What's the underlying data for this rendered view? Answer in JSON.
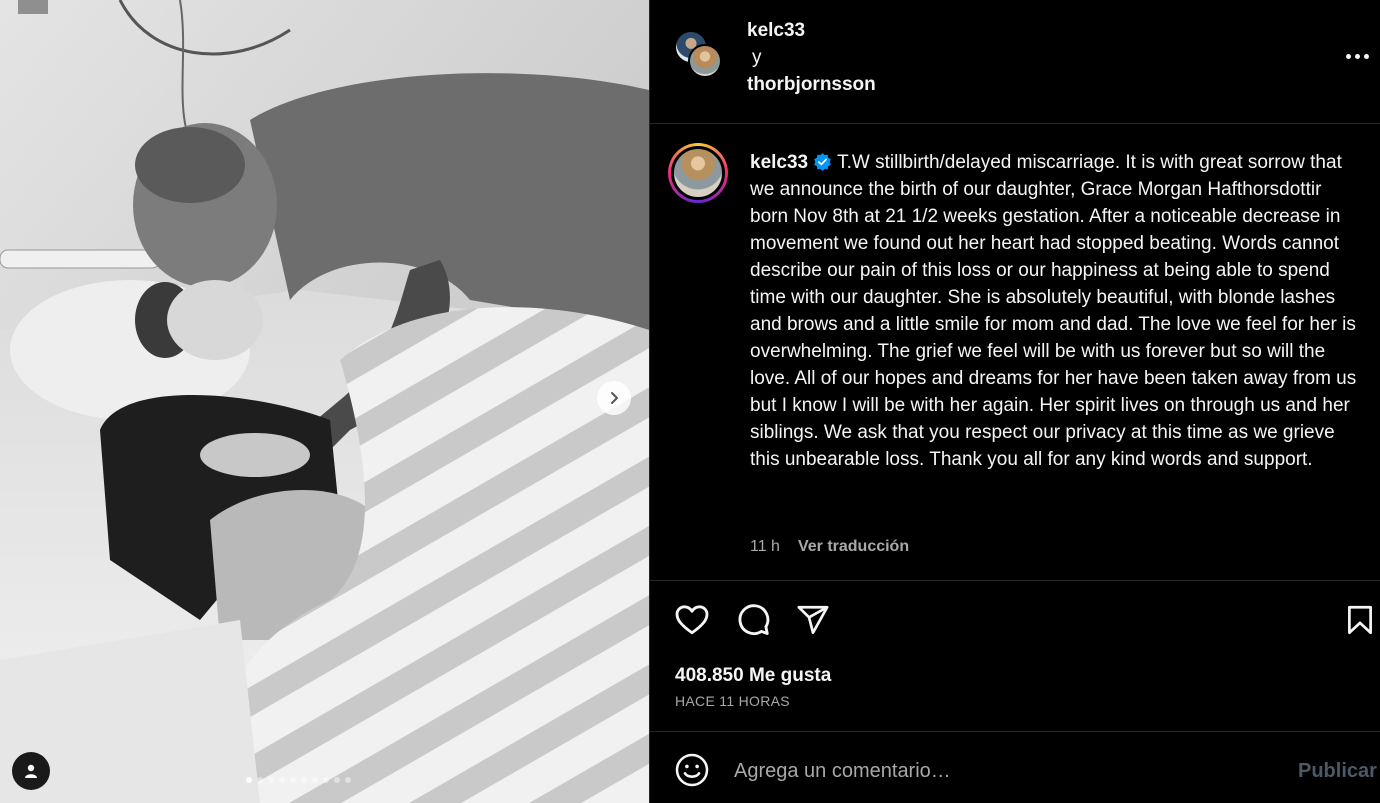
{
  "media": {
    "next_icon": "chevron-right-icon",
    "tag_icon": "user-icon",
    "slide_count": 10,
    "active_slide": 1
  },
  "header": {
    "user1": "kelc33",
    "conjunction": "y",
    "user2": "thorbjornsson",
    "more_icon": "more-horizontal-icon"
  },
  "caption": {
    "username": "kelc33",
    "verified_icon": "verified-badge-icon",
    "text": "T.W stillbirth/delayed miscarriage. It is with great sorrow that we announce the birth of our daughter, Grace Morgan Hafthorsdottir born Nov 8th at 21 1/2 weeks gestation. After a noticeable decrease in movement we found out her heart had stopped beating. Words cannot describe our pain of this loss or our happiness at being able to spend time with our daughter. She is absolutely beautiful, with blonde lashes and brows and a little smile for mom and dad. The love we feel for her is overwhelming. The grief we feel will be with us forever but so will the love. All of our hopes and dreams for her have been taken away from us but I know I will be with her again. Her spirit lives on through us and her siblings. We ask that you respect our privacy at this time as we grieve this unbearable loss. Thank you all for any kind words and support.",
    "time": "11 h",
    "translate": "Ver traducción"
  },
  "actions": {
    "like_icon": "heart-icon",
    "comment_icon": "comment-icon",
    "share_icon": "send-icon",
    "save_icon": "bookmark-icon"
  },
  "stats": {
    "likes": "408.850 Me gusta",
    "posted": "HACE 11 HORAS"
  },
  "comment": {
    "emoji_icon": "emoji-icon",
    "placeholder": "Agrega un comentario…",
    "publish": "Publicar"
  },
  "colors": {
    "background": "#000000",
    "text": "#f5f5f5",
    "muted": "#a8a8a8",
    "verified": "#0095f6",
    "publish_disabled": "#4a5a66"
  }
}
